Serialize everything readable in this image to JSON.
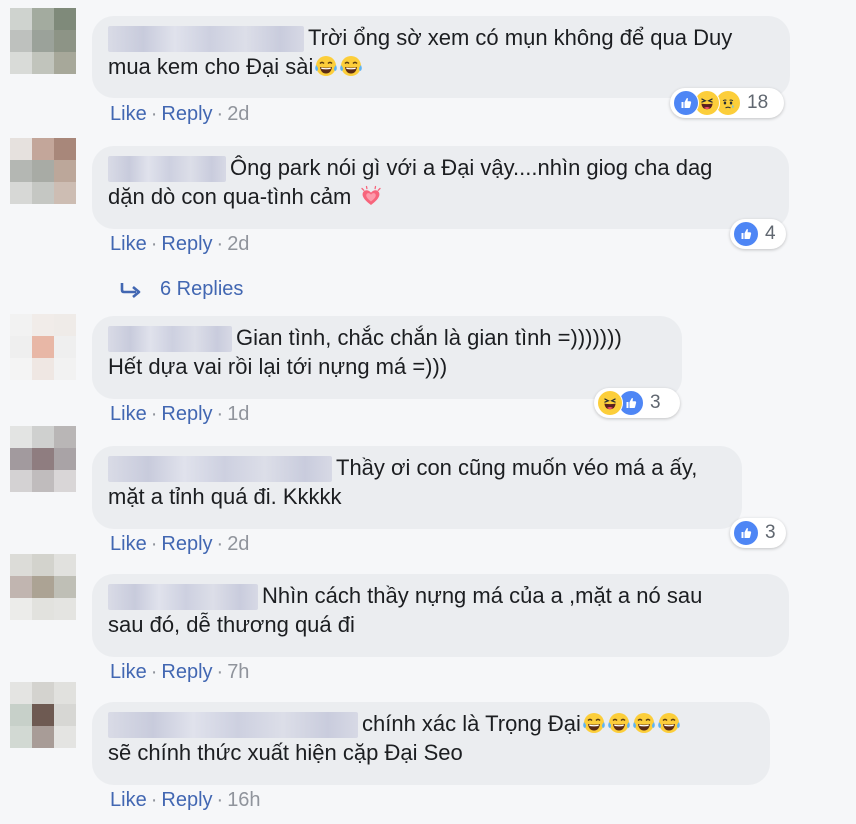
{
  "comments": [
    {
      "text_lines": [
        "Trời ổng sờ xem có mụn không để qua Duy",
        "mua kem cho Đại sài"
      ],
      "like": "Like",
      "reply": "Reply",
      "time": "2d",
      "reaction_count": "18",
      "reactions": [
        "like-icon",
        "haha-icon",
        "sad-icon"
      ]
    },
    {
      "text_lines": [
        "Ông park nói gì với a Đại vậy....nhìn giog cha dag",
        "dặn dò con qua-tình cảm"
      ],
      "like": "Like",
      "reply": "Reply",
      "time": "2d",
      "reaction_count": "4",
      "reactions": [
        "like-icon"
      ]
    },
    {
      "text_lines": [
        "Gian tình, chắc chắn là gian tình =)))))))",
        "Hết dựa vai rồi lại tới nựng má =)))"
      ],
      "like": "Like",
      "reply": "Reply",
      "time": "1d",
      "reaction_count": "3",
      "reactions": [
        "haha-icon",
        "like-icon"
      ]
    },
    {
      "text_lines": [
        "Thầy ơi con cũng muốn véo má a ấy,",
        "mặt a tỉnh quá đi. Kkkkk"
      ],
      "like": "Like",
      "reply": "Reply",
      "time": "2d",
      "reaction_count": "3",
      "reactions": [
        "like-icon"
      ]
    },
    {
      "text_lines": [
        "Nhìn cách thầy nựng má của a ,mặt a nó sau",
        "sau đó, dễ thương quá đi"
      ],
      "like": "Like",
      "reply": "Reply",
      "time": "7h"
    },
    {
      "text_lines": [
        "chính xác là Trọng Đại",
        "sẽ chính thức xuất hiện cặp Đại Seo"
      ],
      "like": "Like",
      "reply": "Reply",
      "time": "16h"
    }
  ],
  "replies_link": "6 Replies",
  "emojis": {
    "c0": "tears-of-joy-emoji x2",
    "c1": "growing-heart-emoji",
    "c5": "tears-of-joy-emoji x4"
  },
  "colors": {
    "background": "#f6f7f9",
    "bubble": "#ebedf0",
    "link": "#4267b2",
    "meta": "#90949c",
    "like_blue": "#4e86f5",
    "emoji_yellow": "#fcce3a"
  }
}
